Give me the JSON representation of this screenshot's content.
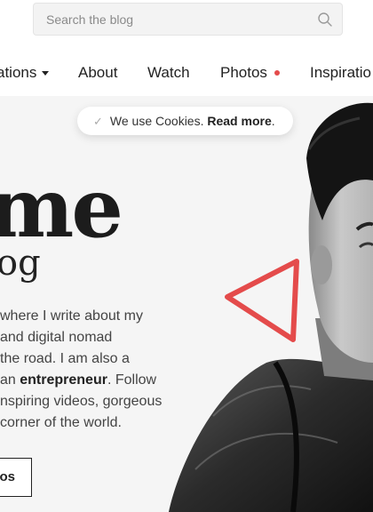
{
  "search": {
    "placeholder": "Search the blog",
    "icon": "search-icon"
  },
  "nav": {
    "items": [
      {
        "label": "ations",
        "has_dropdown": true
      },
      {
        "label": "About"
      },
      {
        "label": "Watch"
      },
      {
        "label": "Photos",
        "has_badge": true
      },
      {
        "label": "Inspiratio"
      }
    ]
  },
  "cookie": {
    "text": "We use Cookies.",
    "link": "Read more",
    "suffix": "."
  },
  "hero": {
    "title": "me",
    "subtitle": "og",
    "paragraph": {
      "line1": "where I write about my",
      "line2": " and digital nomad",
      "line3": "the road. I am also a",
      "line4a": "an ",
      "line4b": "entrepreneur",
      "line4c": ". Follow",
      "line5": "nspiring videos, gorgeous",
      "line6": " corner of the world."
    },
    "cta_label": "os"
  },
  "colors": {
    "accent": "#e44b4b",
    "text": "#222222",
    "hero_bg": "#f5f5f5"
  }
}
